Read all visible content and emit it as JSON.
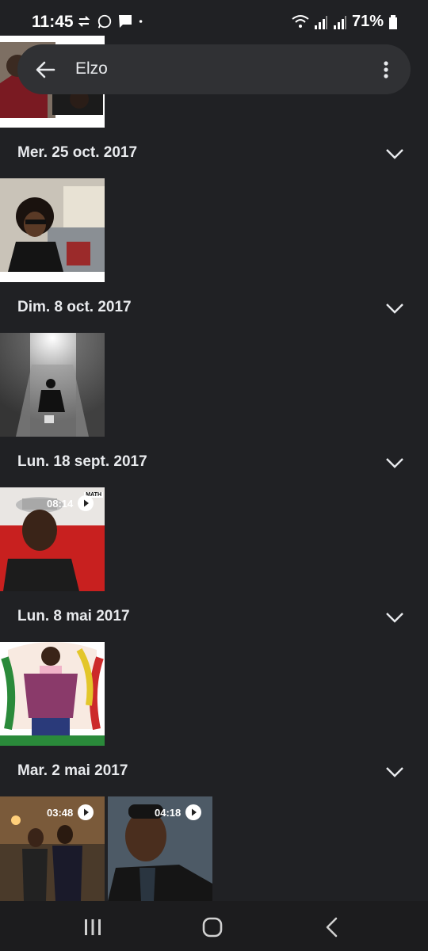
{
  "status_bar": {
    "time": "11:45",
    "battery": "71%"
  },
  "search": {
    "query": "Elzo"
  },
  "sections": [
    {
      "date": "Mer. 25 oct. 2017"
    },
    {
      "date": "Dim. 8 oct. 2017"
    },
    {
      "date": "Lun. 18 sept. 2017"
    },
    {
      "date": "Lun. 8 mai 2017"
    },
    {
      "date": "Mar. 2 mai 2017"
    }
  ],
  "videos": {
    "sept18": {
      "duration": "08:14",
      "tag": "MATH"
    },
    "may2_a": {
      "duration": "03:48"
    },
    "may2_b": {
      "duration": "04:18"
    }
  },
  "icons": {
    "back": "arrow-left-icon",
    "more": "more-vert-icon",
    "chevron": "chevron-down-icon",
    "play": "play-circle-icon",
    "nav_recents": "recents-icon",
    "nav_home": "home-icon",
    "nav_back": "nav-back-icon"
  },
  "colors": {
    "background": "#202124",
    "searchbar": "#303134",
    "text": "#e8eaed"
  }
}
